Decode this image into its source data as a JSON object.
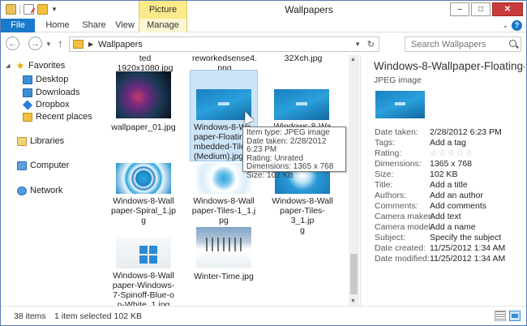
{
  "window": {
    "title": "Wallpapers",
    "context_tab": "Picture Tools",
    "controls": [
      "–",
      "□",
      "✕"
    ]
  },
  "ribbon": {
    "tabs": [
      "File",
      "Home",
      "Share",
      "View",
      "Manage"
    ]
  },
  "address": {
    "path": "Wallpapers",
    "search_placeholder": "Search Wallpapers"
  },
  "nav": {
    "favorites": "Favorites",
    "items": [
      "Desktop",
      "Downloads",
      "Dropbox",
      "Recent places"
    ],
    "libraries": "Libraries",
    "computer": "Computer",
    "network": "Network"
  },
  "files": {
    "cutoff": [
      "ted 1920x1080.jpg",
      "reworkedsense4.\npng",
      "32Xch.jpg"
    ],
    "row1": [
      {
        "label": "wallpaper_01.jpg"
      },
      {
        "label": "Windows-8-Wa\npaper-Floating\nmbedded-Tiles\n(Medium).jpg"
      },
      {
        "label": "Windows-8-Wa"
      }
    ],
    "row2": [
      {
        "label": "Windows-8-Wall\npaper-Spiral_1.jp\ng"
      },
      {
        "label": "Windows-8-Wall\npaper-Tiles-1_1.j\npg"
      },
      {
        "label": "Windows-8-Wall\npaper-Tiles-3_1.jp\ng"
      }
    ],
    "row3": [
      {
        "label": "Windows-8-Wall\npaper-Windows-\n7-Spinoff-Blue-o\nn-White_1.jpg"
      },
      {
        "label": "Winter-Time.jpg"
      }
    ]
  },
  "tooltip": {
    "lines": [
      "Item type: JPEG image",
      "Date taken: 2/28/2012 6:23 PM",
      "Rating: Unrated",
      "Dimensions: 1365 x 768",
      "Size: 102 KB"
    ]
  },
  "details": {
    "title": "Windows-8-Wallpaper-Floating-",
    "type": "JPEG image",
    "props": [
      {
        "label": "Date taken:",
        "value": "2/28/2012 6:23 PM"
      },
      {
        "label": "Tags:",
        "value": "Add a tag"
      },
      {
        "label": "Rating:",
        "value": "☆☆☆☆☆"
      },
      {
        "label": "Dimensions:",
        "value": "1365 x 768"
      },
      {
        "label": "Size:",
        "value": "102 KB"
      },
      {
        "label": "Title:",
        "value": "Add a title"
      },
      {
        "label": "Authors:",
        "value": "Add an author"
      },
      {
        "label": "Comments:",
        "value": "Add comments"
      },
      {
        "label": "Camera maker:",
        "value": "Add text"
      },
      {
        "label": "Camera model:",
        "value": "Add a name"
      },
      {
        "label": "Subject:",
        "value": "Specify the subject"
      },
      {
        "label": "Date created:",
        "value": "11/25/2012 1:34 AM"
      },
      {
        "label": "Date modified:",
        "value": "11/25/2012 1:34 AM"
      }
    ]
  },
  "status": {
    "count": "38 items",
    "selection": "1 item selected  102 KB"
  }
}
